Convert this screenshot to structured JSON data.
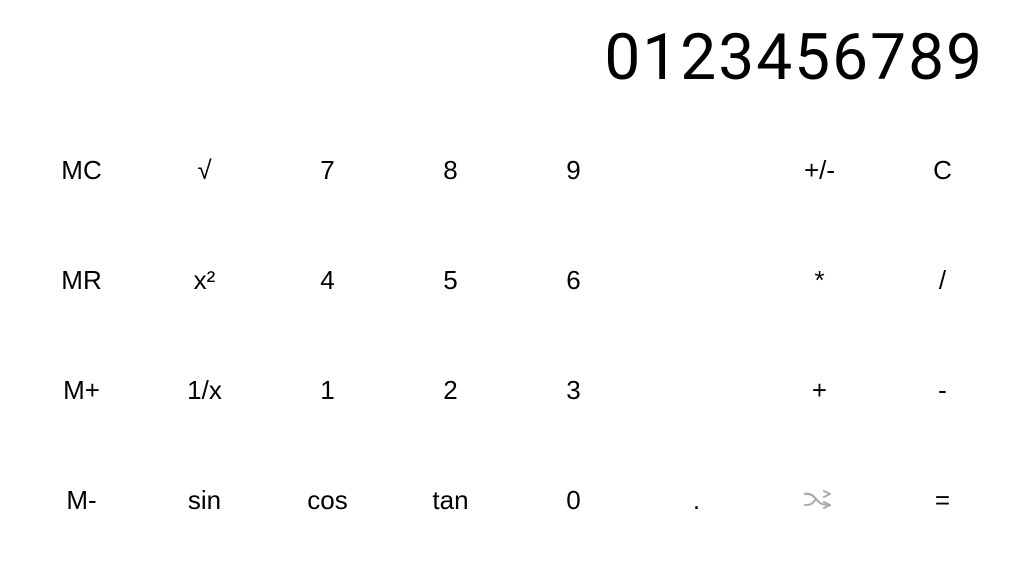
{
  "display": {
    "value": "0123456789"
  },
  "buttons": {
    "row1": [
      {
        "label": "MC",
        "name": "mc-button"
      },
      {
        "label": "√",
        "name": "sqrt-button"
      },
      {
        "label": "7",
        "name": "seven-button"
      },
      {
        "label": "8",
        "name": "eight-button"
      },
      {
        "label": "9",
        "name": "nine-button"
      },
      {
        "label": "+/-",
        "name": "plus-minus-button"
      },
      {
        "label": "C",
        "name": "clear-button"
      }
    ],
    "row2": [
      {
        "label": "MR",
        "name": "mr-button"
      },
      {
        "label": "x²",
        "name": "square-button"
      },
      {
        "label": "4",
        "name": "four-button"
      },
      {
        "label": "5",
        "name": "five-button"
      },
      {
        "label": "6",
        "name": "six-button"
      },
      {
        "label": "*",
        "name": "multiply-button"
      },
      {
        "label": "/",
        "name": "divide-button"
      }
    ],
    "row3": [
      {
        "label": "M+",
        "name": "mplus-button"
      },
      {
        "label": "1/x",
        "name": "reciprocal-button"
      },
      {
        "label": "1",
        "name": "one-button"
      },
      {
        "label": "2",
        "name": "two-button"
      },
      {
        "label": "3",
        "name": "three-button"
      },
      {
        "label": "+",
        "name": "add-button"
      },
      {
        "label": "-",
        "name": "subtract-button"
      }
    ],
    "row4": [
      {
        "label": "M-",
        "name": "mminus-button"
      },
      {
        "label": "sin",
        "name": "sin-button"
      },
      {
        "label": "cos",
        "name": "cos-button"
      },
      {
        "label": "tan",
        "name": "tan-button"
      },
      {
        "label": "0",
        "name": "zero-button"
      },
      {
        "label": ".",
        "name": "decimal-button"
      },
      {
        "label": "shuffle",
        "name": "shuffle-button"
      },
      {
        "label": "=",
        "name": "equals-button"
      }
    ]
  }
}
